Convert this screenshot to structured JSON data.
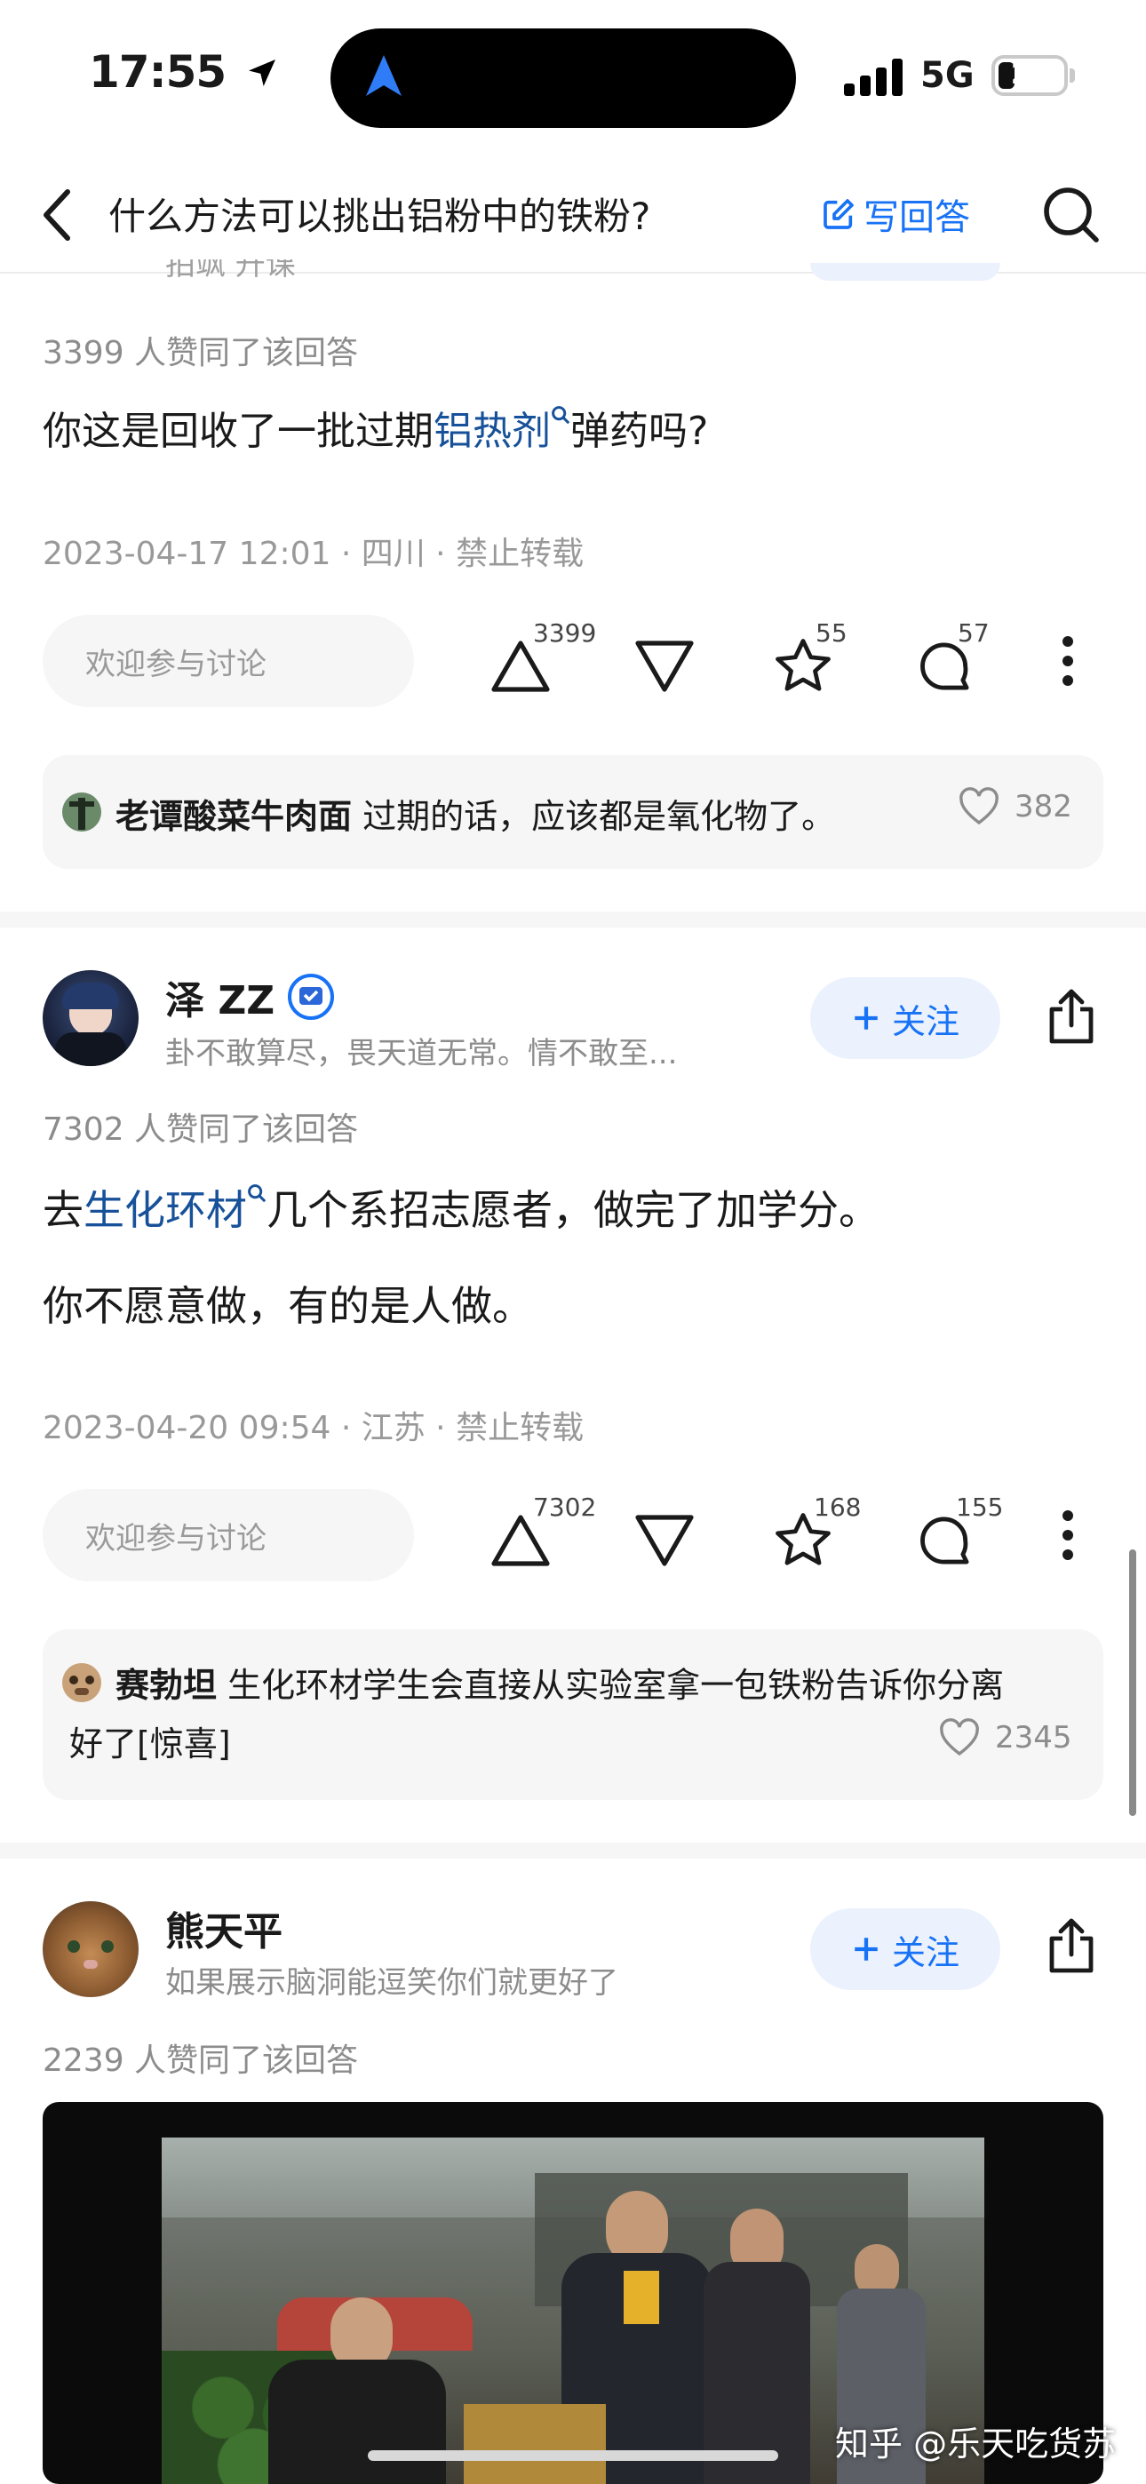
{
  "status_bar": {
    "time": "17:55",
    "network": "5G",
    "battery": "26"
  },
  "nav": {
    "title": "什么方法可以挑出铝粉中的铁粉?",
    "write_answer": "写回答"
  },
  "partial_top": {
    "bio_fragment": "拍飒 升课"
  },
  "answer1": {
    "agree": "3399 人赞同了该回答",
    "text_before": "你这是回收了一批过期",
    "text_link": "铝热剂",
    "text_after": "弹药吗?",
    "meta": "2023-04-17 12:01 · 四川 · 禁止转载",
    "discuss_placeholder": "欢迎参与讨论",
    "upvotes": "3399",
    "favorites": "55",
    "comments": "57",
    "top_comment": {
      "user": "老谭酸菜牛肉面",
      "text": "过期的话，应该都是氧化物了。",
      "likes": "382"
    }
  },
  "answer2": {
    "author": "泽 ZZ",
    "bio": "卦不敢算尽，畏天道无常。情不敢至...",
    "follow": "关注",
    "agree": "7302 人赞同了该回答",
    "p1_before": "去",
    "p1_link": "生化环材",
    "p1_after": "几个系招志愿者，做完了加学分。",
    "p2": "你不愿意做，有的是人做。",
    "meta": "2023-04-20 09:54 · 江苏 · 禁止转载",
    "discuss_placeholder": "欢迎参与讨论",
    "upvotes": "7302",
    "favorites": "168",
    "comments": "155",
    "top_comment": {
      "user": "赛勃坦",
      "text_line1": "生化环材学生会直接从实验室拿一包铁粉告诉你分离",
      "text_line2": "好了[惊喜]",
      "likes": "2345"
    }
  },
  "answer3": {
    "author": "熊天平",
    "bio": "如果展示脑洞能逗笑你们就更好了",
    "follow": "关注",
    "agree": "2239 人赞同了该回答"
  },
  "watermark": "知乎 @乐天吃货苏",
  "colors": {
    "accent": "#1772f6",
    "link": "#175199",
    "background": "#ffffff",
    "muted": "#8c8c8c"
  }
}
